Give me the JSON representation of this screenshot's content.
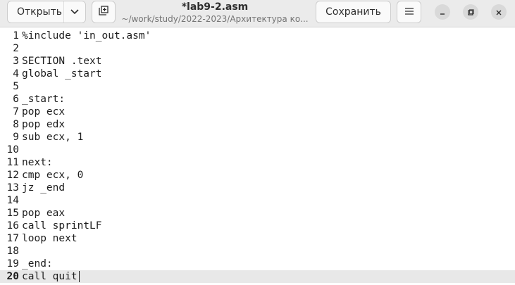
{
  "header": {
    "open_label": "Открыть",
    "save_label": "Сохранить",
    "title": "*lab9-2.asm",
    "subtitle": "~/work/study/2022-2023/Архитектура ко..."
  },
  "icons": {
    "open_dropdown": "chevron-down-icon",
    "new_tab": "new-tab-icon",
    "menu": "hamburger-menu-icon",
    "minimize": "minimize-icon",
    "maximize": "maximize-icon",
    "close": "close-icon"
  },
  "editor": {
    "current_line": 20,
    "lines": [
      {
        "n": "1",
        "text": "%include 'in_out.asm'"
      },
      {
        "n": "2",
        "text": ""
      },
      {
        "n": "3",
        "text": "SECTION .text"
      },
      {
        "n": "4",
        "text": "global _start"
      },
      {
        "n": "5",
        "text": ""
      },
      {
        "n": "6",
        "text": "_start:"
      },
      {
        "n": "7",
        "text": "pop ecx"
      },
      {
        "n": "8",
        "text": "pop edx"
      },
      {
        "n": "9",
        "text": "sub ecx, 1"
      },
      {
        "n": "10",
        "text": ""
      },
      {
        "n": "11",
        "text": "next:"
      },
      {
        "n": "12",
        "text": "cmp ecx, 0"
      },
      {
        "n": "13",
        "text": "jz _end"
      },
      {
        "n": "14",
        "text": ""
      },
      {
        "n": "15",
        "text": "pop eax"
      },
      {
        "n": "16",
        "text": "call sprintLF"
      },
      {
        "n": "17",
        "text": "loop next"
      },
      {
        "n": "18",
        "text": ""
      },
      {
        "n": "19",
        "text": "_end:"
      },
      {
        "n": "20",
        "text": "call quit"
      }
    ]
  }
}
